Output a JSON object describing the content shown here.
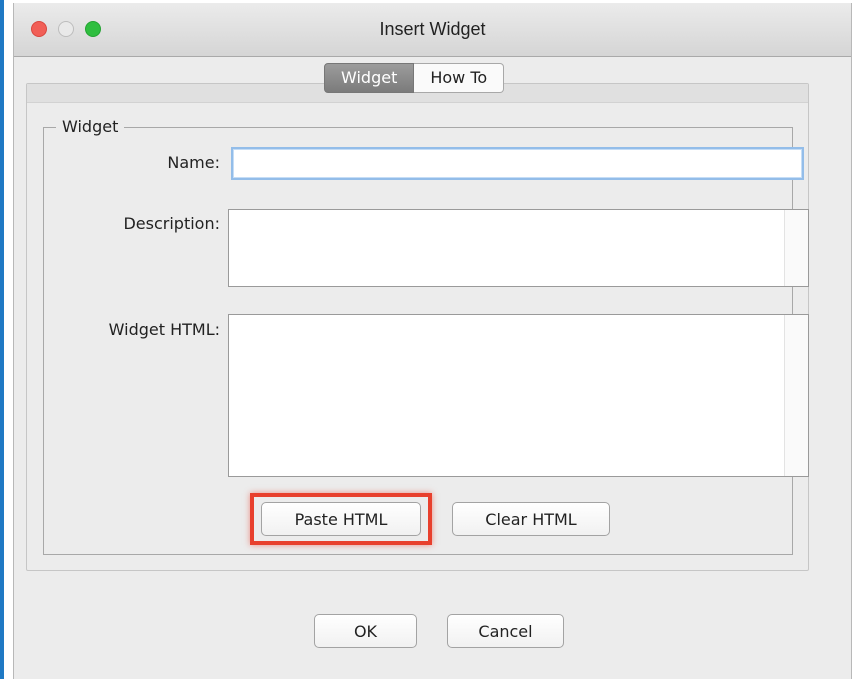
{
  "window": {
    "title": "Insert Widget",
    "traffic_lights": [
      "close-light",
      "minimize-light",
      "maximize-light"
    ]
  },
  "tabs": [
    {
      "label": "Widget",
      "active": true
    },
    {
      "label": "How To",
      "active": false
    }
  ],
  "group": {
    "legend": "Widget",
    "name_label": "Name:",
    "name_value": "",
    "description_label": "Description:",
    "description_value": "",
    "html_label": "Widget HTML:",
    "html_value": "",
    "paste_button": "Paste HTML",
    "clear_button": "Clear HTML"
  },
  "footer": {
    "ok_button": "OK",
    "cancel_button": "Cancel"
  },
  "colors": {
    "highlight": "#e8402d",
    "focus_ring": "#93bde9",
    "window_bg": "#ececec"
  }
}
